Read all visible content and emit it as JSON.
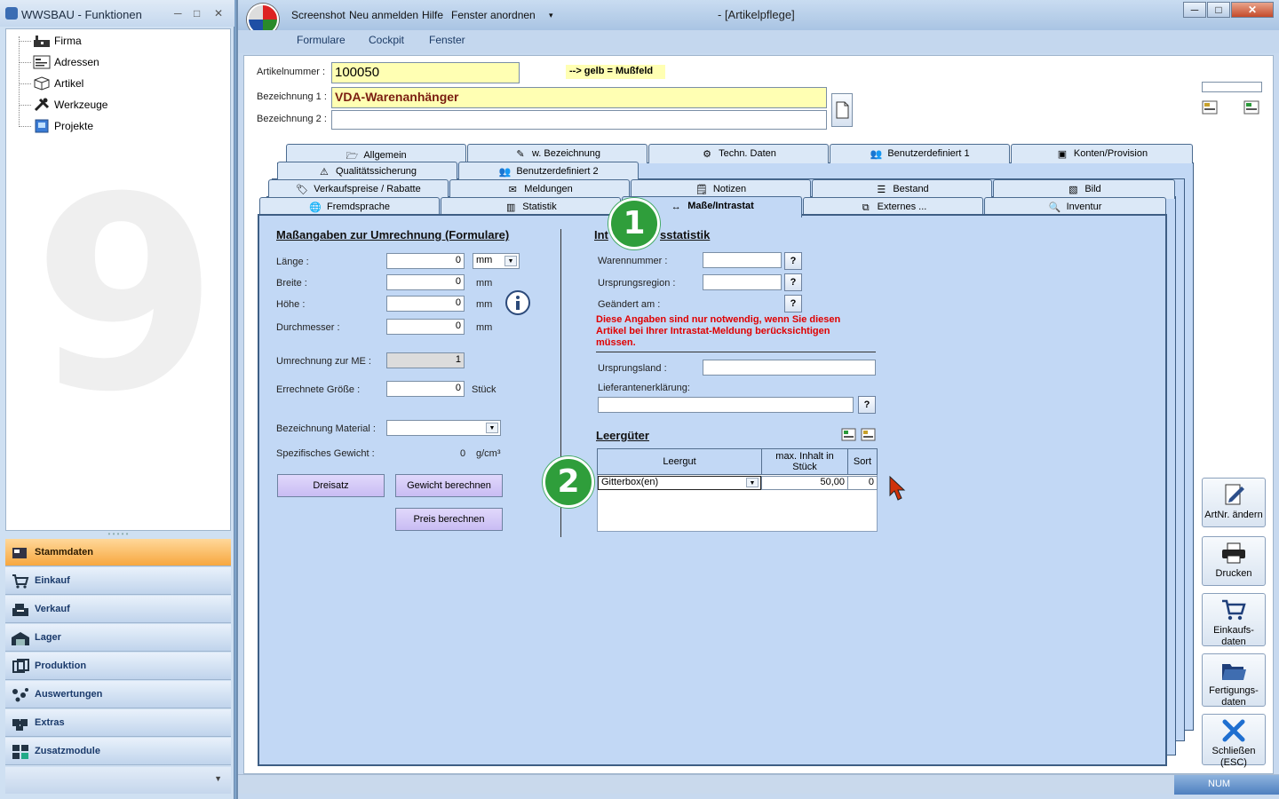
{
  "left_window": {
    "title": "WWSBAU - Funktionen",
    "tree": [
      {
        "label": "Firma",
        "icon": "factory-icon"
      },
      {
        "label": "Adressen",
        "icon": "address-card-icon"
      },
      {
        "label": "Artikel",
        "icon": "box-icon"
      },
      {
        "label": "Werkzeuge",
        "icon": "tools-icon"
      },
      {
        "label": "Projekte",
        "icon": "project-icon"
      }
    ],
    "watermark": "9",
    "nav": [
      {
        "label": "Stammdaten",
        "active": true
      },
      {
        "label": "Einkauf"
      },
      {
        "label": "Verkauf"
      },
      {
        "label": "Lager"
      },
      {
        "label": "Produktion"
      },
      {
        "label": "Auswertungen"
      },
      {
        "label": "Extras"
      },
      {
        "label": "Zusatzmodule"
      }
    ]
  },
  "main_window": {
    "caption": "- [Artikelpflege]",
    "quick_menu": [
      "Screenshot",
      "Neu anmelden",
      "Hilfe",
      "Fenster anordnen"
    ],
    "ribbon_tabs": [
      "Formulare",
      "Cockpit",
      "Fenster"
    ]
  },
  "header_fields": {
    "artikelnummer_label": "Artikelnummer :",
    "artikelnummer_value": "100050",
    "hint": "--> gelb = Mußfeld",
    "bezeichnung1_label": "Bezeichnung 1 :",
    "bezeichnung1_value": "VDA-Warenanhänger",
    "bezeichnung2_label": "Bezeichnung 2 :",
    "bezeichnung2_value": ""
  },
  "tabs": {
    "row1": [
      "Allgemein",
      "w. Bezeichnung",
      "Techn. Daten",
      "Benutzerdefiniert 1",
      "Konten/Provision"
    ],
    "row2": [
      "Qualitätssicherung",
      "Benutzerdefiniert 2"
    ],
    "row3": [
      "Verkaufspreise / Rabatte",
      "Meldungen",
      "Notizen",
      "Bestand",
      "Bild"
    ],
    "row4": [
      "Fremdsprache",
      "Statistik",
      "Maße/Intrastat",
      "Externes ...",
      "Inventur"
    ]
  },
  "masse": {
    "title": "Maßangaben zur Umrechnung (Formulare)",
    "laenge_label": "Länge :",
    "laenge_value": "0",
    "laenge_unit": "mm",
    "breite_label": "Breite :",
    "breite_value": "0",
    "breite_unit": "mm",
    "hoehe_label": "Höhe :",
    "hoehe_value": "0",
    "hoehe_unit": "mm",
    "durchmesser_label": "Durchmesser :",
    "durchmesser_value": "0",
    "durchmesser_unit": "mm",
    "umrechnung_label": "Umrechnung zur ME :",
    "umrechnung_value": "1",
    "errechnete_label": "Errechnete Größe :",
    "errechnete_value": "0",
    "errechnete_unit": "Stück",
    "material_label": "Bezeichnung Material :",
    "material_value": "",
    "gewicht_label": "Spezifisches Gewicht :",
    "gewicht_value": "0",
    "gewicht_unit": "g/cm³",
    "btn_dreisatz": "Dreisatz",
    "btn_gewicht": "Gewicht berechnen",
    "btn_preis": "Preis berechnen"
  },
  "intrastat": {
    "title_a": "Int",
    "title_b": "sstatistik",
    "warennummer_label": "Warennummer :",
    "warennummer_value": "",
    "ursprungsregion_label": "Ursprungsregion :",
    "ursprungsregion_value": "",
    "geaendert_label": "Geändert am :",
    "warning": "Diese Angaben sind nur notwendig, wenn Sie diesen Artikel bei Ihrer Intrastat-Meldung berücksichtigen müssen.",
    "ursprungsland_label": "Ursprungsland :",
    "ursprungsland_value": "",
    "lieferanten_label": "Lieferantenerklärung:",
    "lieferanten_value": "",
    "q": "?"
  },
  "leergueter": {
    "title": "Leergüter",
    "columns": [
      "Leergut",
      "max. Inhalt in Stück",
      "Sort"
    ],
    "rows": [
      {
        "leergut": "Gitterbox(en)",
        "max": "50,00",
        "sort": "0"
      }
    ]
  },
  "badges": [
    "1",
    "2"
  ],
  "side_buttons": [
    {
      "label": "ArtNr. ändern"
    },
    {
      "label": "Drucken"
    },
    {
      "label": "Einkaufs-daten"
    },
    {
      "label": "Fertigungs-daten"
    },
    {
      "label": "Schließen (ESC)"
    }
  ],
  "status": {
    "num": "NUM"
  }
}
